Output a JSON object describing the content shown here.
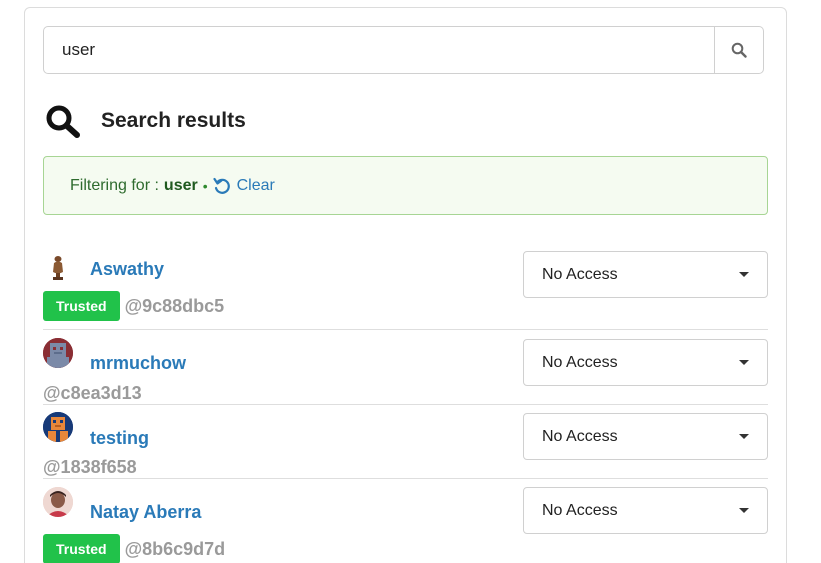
{
  "search": {
    "value": "user"
  },
  "results": {
    "title": "Search results"
  },
  "filter": {
    "label": "Filtering for :",
    "term": "user",
    "separator": "•",
    "clear_label": "Clear"
  },
  "colors": {
    "link": "#2a7ab8",
    "trusted_badge": "#21c24a",
    "filter_bg": "#f5fbf1",
    "filter_border": "#a7d594"
  },
  "users": [
    {
      "name": "Aswathy",
      "badge": "Trusted",
      "handle": "@9c88dbc5",
      "access": "No Access",
      "avatar_icon": "idol-avatar-icon"
    },
    {
      "name": "mrmuchow",
      "badge": "",
      "handle": "@c8ea3d13",
      "access": "No Access",
      "avatar_icon": "pixel-avatar-icon"
    },
    {
      "name": "testing",
      "badge": "",
      "handle": "@1838f658",
      "access": "No Access",
      "avatar_icon": "pixel-avatar-icon"
    },
    {
      "name": "Natay Aberra",
      "badge": "Trusted",
      "handle": "@8b6c9d7d",
      "access": "No Access",
      "avatar_icon": "photo-avatar-icon"
    }
  ]
}
